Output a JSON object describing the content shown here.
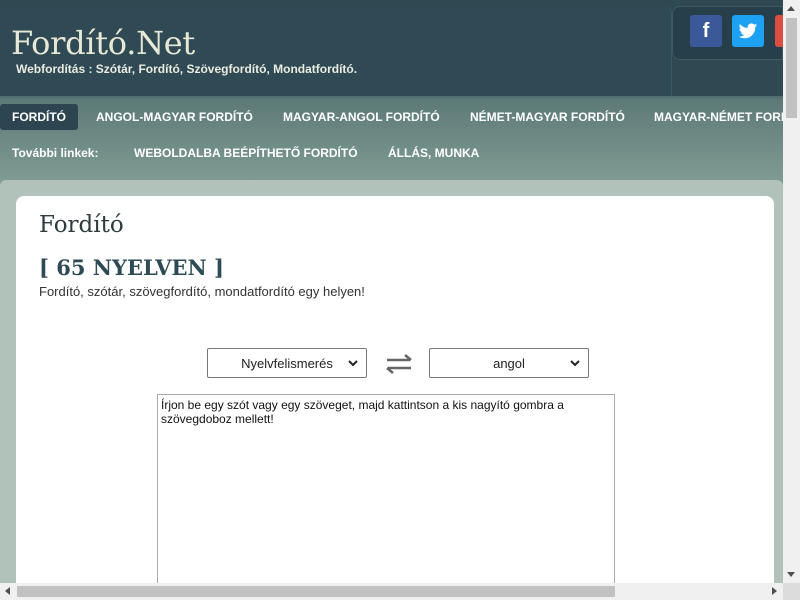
{
  "site": {
    "logo": "Fordító.Net",
    "tagline": "Webfordítás : Szótár, Fordító, Szövegfordító, Mondatfordító."
  },
  "social": {
    "facebook": "f",
    "google": "g"
  },
  "nav": {
    "primary": [
      {
        "label": "FORDÍTÓ",
        "active": true
      },
      {
        "label": "ANGOL-MAGYAR FORDÍTÓ"
      },
      {
        "label": "MAGYAR-ANGOL FORDÍTÓ"
      },
      {
        "label": "NÉMET-MAGYAR FORDÍTÓ"
      },
      {
        "label": "MAGYAR-NÉMET FORDÍTÓ"
      }
    ],
    "secondary_label": "További linkek:",
    "secondary": [
      {
        "label": "WEBOLDALBA BEÉPÍTHETŐ FORDÍTÓ"
      },
      {
        "label": "ÁLLÁS, MUNKA"
      }
    ]
  },
  "main": {
    "title": "Fordító",
    "subtitle": "[ 65 NYELVEN ]",
    "description": "Fordító, szótár, szövegfordító, mondatfordító egy helyen!",
    "source_language": "Nyelvfelismerés",
    "target_language": "angol",
    "textarea_placeholder": "Írjon be egy szót vagy egy szöveget, majd kattintson a kis nagyító gombra a szövegdoboz mellett!"
  },
  "colors": {
    "header_bg": "#2f4953",
    "nav_active_bg": "#2d4550",
    "facebook": "#3b5998",
    "twitter": "#1da1f2",
    "google": "#dc4e41"
  }
}
